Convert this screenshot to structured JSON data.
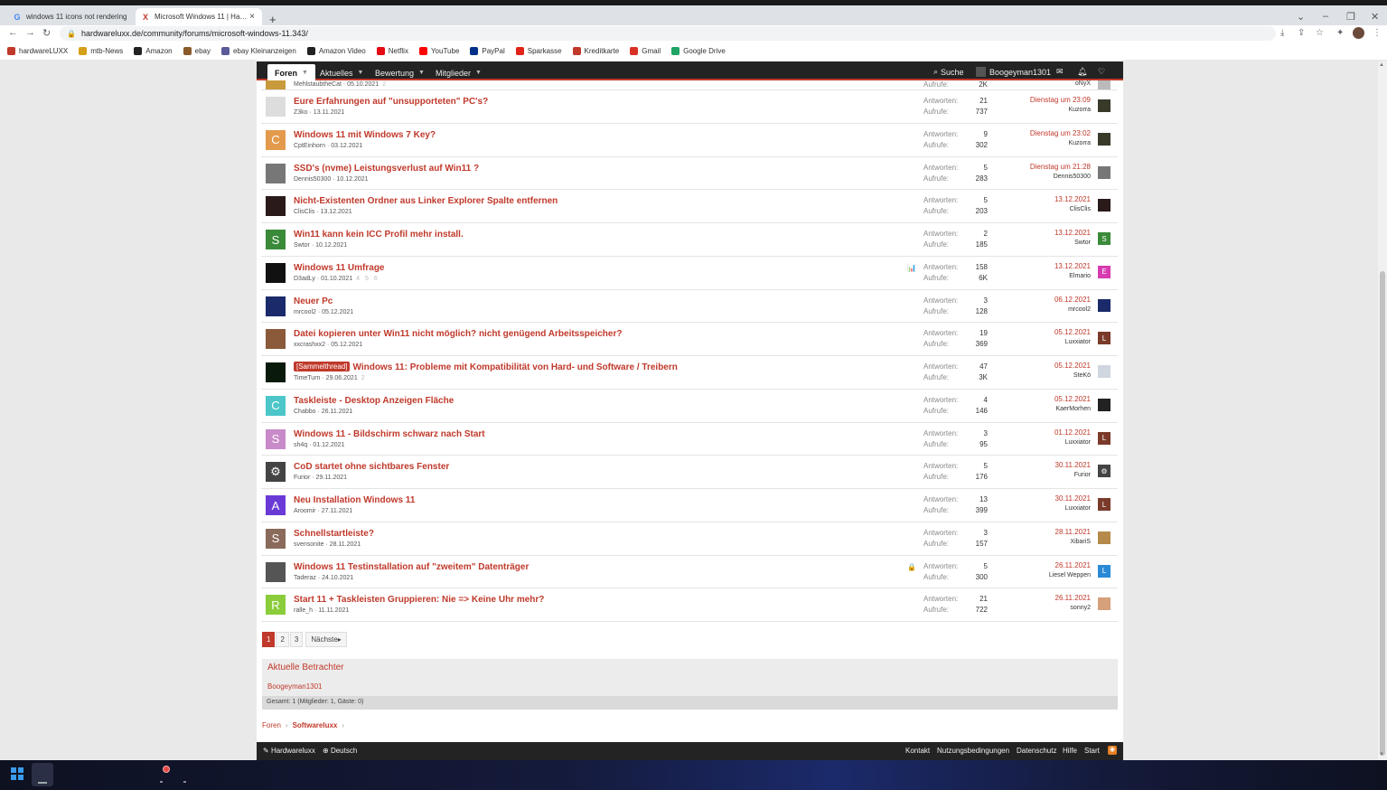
{
  "browser": {
    "tabs": [
      {
        "title": "windows 11 icons not rendering",
        "active": false,
        "favicon": "google-icon"
      },
      {
        "title": "Microsoft Windows 11 | Hardwareluxx",
        "active": true,
        "favicon": "hardwareluxx-icon"
      }
    ],
    "url": "hardwareluxx.de/community/forums/microsoft-windows-11.343/",
    "bookmarks": [
      {
        "label": "hardwareLUXX",
        "icon": "hardwareluxx-icon",
        "color": "#c0392b"
      },
      {
        "label": "mtb-News",
        "icon": "mtb-icon",
        "color": "#d4a017"
      },
      {
        "label": "Amazon",
        "icon": "amazon-icon",
        "color": "#222222"
      },
      {
        "label": "ebay",
        "icon": "ebay-icon",
        "color": "#8a5a2b"
      },
      {
        "label": "ebay Kleinanzeigen",
        "icon": "kleinanzeigen-icon",
        "color": "#5a5a9a"
      },
      {
        "label": "Amazon Video",
        "icon": "amazon-icon",
        "color": "#222222"
      },
      {
        "label": "Netflix",
        "icon": "netflix-icon",
        "color": "#e50914"
      },
      {
        "label": "YouTube",
        "icon": "youtube-icon",
        "color": "#ff0000"
      },
      {
        "label": "PayPal",
        "icon": "paypal-icon",
        "color": "#003087"
      },
      {
        "label": "Sparkasse",
        "icon": "sparkasse-icon",
        "color": "#e2231a"
      },
      {
        "label": "Kreditkarte",
        "icon": "card-icon",
        "color": "#c0392b"
      },
      {
        "label": "Gmail",
        "icon": "gmail-icon",
        "color": "#d93025"
      },
      {
        "label": "Google Drive",
        "icon": "drive-icon",
        "color": "#1fa463"
      }
    ]
  },
  "forum_nav": {
    "items": [
      "Foren",
      "Aktuelles",
      "Bewertung",
      "Mitglieder"
    ],
    "search": "Suche",
    "username": "Boogeyman1301"
  },
  "labels": {
    "replies": "Antworten:",
    "views": "Aufrufe:"
  },
  "threads": [
    {
      "title": "",
      "prefix": "",
      "author": "MehlstaubtheCat",
      "date": "05.10.2021",
      "pages": "2",
      "replies": "",
      "views": "2K",
      "last_date": "",
      "last_user": "oNyX",
      "status_icon": "",
      "av_letter": "",
      "av_color": "#c99a3a",
      "lav_letter": "",
      "lav_color": "#bbbbbb",
      "partial": true
    },
    {
      "title": "Eure Erfahrungen auf \"unsupporteten\" PC's?",
      "prefix": "",
      "author": "Z3ko",
      "date": "13.11.2021",
      "pages": "",
      "replies": "21",
      "views": "737",
      "last_date": "Dienstag um 23:09",
      "last_user": "Kuzorra",
      "status_icon": "",
      "av_letter": "",
      "av_color": "#dddddd",
      "lav_letter": "",
      "lav_color": "#3a3a2a"
    },
    {
      "title": "Windows 11 mit Windows 7 Key?",
      "prefix": "",
      "author": "CptEinhorn",
      "date": "03.12.2021",
      "pages": "",
      "replies": "9",
      "views": "302",
      "last_date": "Dienstag um 23:02",
      "last_user": "Kuzorra",
      "status_icon": "",
      "av_letter": "C",
      "av_color": "#e39a4c",
      "lav_letter": "",
      "lav_color": "#3a3a2a"
    },
    {
      "title": "SSD's (nvme) Leistungsverlust auf Win11 ?",
      "prefix": "",
      "author": "Dennis50300",
      "date": "10.12.2021",
      "pages": "",
      "replies": "5",
      "views": "283",
      "last_date": "Dienstag um 21:28",
      "last_user": "Dennis50300",
      "status_icon": "",
      "av_letter": "",
      "av_color": "#777777",
      "lav_letter": "",
      "lav_color": "#777777"
    },
    {
      "title": "Nicht-Existenten Ordner aus Linker Explorer Spalte entfernen",
      "prefix": "",
      "author": "ClisClis",
      "date": "13.12.2021",
      "pages": "",
      "replies": "5",
      "views": "203",
      "last_date": "13.12.2021",
      "last_user": "ClisClis",
      "status_icon": "",
      "av_letter": "",
      "av_color": "#2a1a1a",
      "lav_letter": "",
      "lav_color": "#2a1a1a"
    },
    {
      "title": "Win11 kann kein ICC Profil mehr install.",
      "prefix": "",
      "author": "Swtor",
      "date": "10.12.2021",
      "pages": "",
      "replies": "2",
      "views": "185",
      "last_date": "13.12.2021",
      "last_user": "Swtor",
      "status_icon": "",
      "av_letter": "S",
      "av_color": "#3a8a3a",
      "lav_letter": "S",
      "lav_color": "#3a8a3a"
    },
    {
      "title": "Windows 11 Umfrage",
      "prefix": "",
      "author": "D3adLy",
      "date": "01.10.2021",
      "pages": "4 5 6",
      "replies": "158",
      "views": "6K",
      "last_date": "13.12.2021",
      "last_user": "Elmario",
      "status_icon": "📊",
      "av_letter": "",
      "av_color": "#111111",
      "lav_letter": "E",
      "lav_color": "#d63bb0"
    },
    {
      "title": "Neuer Pc",
      "prefix": "",
      "author": "mrcool2",
      "date": "05.12.2021",
      "pages": "",
      "replies": "3",
      "views": "128",
      "last_date": "06.12.2021",
      "last_user": "mrcool2",
      "status_icon": "",
      "av_letter": "",
      "av_color": "#1a2a6a",
      "lav_letter": "",
      "lav_color": "#1a2a6a"
    },
    {
      "title": "Datei kopieren unter Win11 nicht möglich? nicht genügend Arbeitsspeicher?",
      "prefix": "",
      "author": "xxcrashxx2",
      "date": "05.12.2021",
      "pages": "",
      "replies": "19",
      "views": "369",
      "last_date": "05.12.2021",
      "last_user": "Luxxiator",
      "status_icon": "",
      "av_letter": "",
      "av_color": "#8a5a3a",
      "lav_letter": "L",
      "lav_color": "#7a3a2a"
    },
    {
      "title": "Windows 11: Probleme mit Kompatibilität von Hard- und Software / Treibern",
      "prefix": "[Sammelthread]",
      "author": "TimeTurn",
      "date": "29.06.2021",
      "pages": "2",
      "replies": "47",
      "views": "3K",
      "last_date": "05.12.2021",
      "last_user": "SteKö",
      "status_icon": "",
      "av_letter": "",
      "av_color": "#0a1a0a",
      "lav_letter": "",
      "lav_color": "#d0d6e0"
    },
    {
      "title": "Taskleiste - Desktop Anzeigen Fläche",
      "prefix": "",
      "author": "Chabbo",
      "date": "26.11.2021",
      "pages": "",
      "replies": "4",
      "views": "146",
      "last_date": "05.12.2021",
      "last_user": "KaerMorhen",
      "status_icon": "",
      "av_letter": "C",
      "av_color": "#4cc6c9",
      "lav_letter": "",
      "lav_color": "#222222"
    },
    {
      "title": "Windows 11 - Bildschirm schwarz nach Start",
      "prefix": "",
      "author": "sh4q",
      "date": "01.12.2021",
      "pages": "",
      "replies": "3",
      "views": "95",
      "last_date": "01.12.2021",
      "last_user": "Luxxiator",
      "status_icon": "",
      "av_letter": "S",
      "av_color": "#c98ac9",
      "lav_letter": "L",
      "lav_color": "#7a3a2a"
    },
    {
      "title": "CoD startet ohne sichtbares Fenster",
      "prefix": "",
      "author": "Furior",
      "date": "29.11.2021",
      "pages": "",
      "replies": "5",
      "views": "176",
      "last_date": "30.11.2021",
      "last_user": "Furior",
      "status_icon": "",
      "av_letter": "⚙",
      "av_color": "#444444",
      "lav_letter": "⚙",
      "lav_color": "#444444"
    },
    {
      "title": "Neu Installation Windows 11",
      "prefix": "",
      "author": "Aroomir",
      "date": "27.11.2021",
      "pages": "",
      "replies": "13",
      "views": "399",
      "last_date": "30.11.2021",
      "last_user": "Luxxiator",
      "status_icon": "",
      "av_letter": "A",
      "av_color": "#6a3ad6",
      "lav_letter": "L",
      "lav_color": "#7a3a2a"
    },
    {
      "title": "Schnellstartleiste?",
      "prefix": "",
      "author": "svensonite",
      "date": "28.11.2021",
      "pages": "",
      "replies": "3",
      "views": "157",
      "last_date": "28.11.2021",
      "last_user": "XibariS",
      "status_icon": "",
      "av_letter": "S",
      "av_color": "#8a6a5a",
      "lav_letter": "",
      "lav_color": "#b58a4a"
    },
    {
      "title": "Windows 11 Testinstallation auf \"zweitem\" Datenträger",
      "prefix": "",
      "author": "Taderaz",
      "date": "24.10.2021",
      "pages": "",
      "replies": "5",
      "views": "300",
      "last_date": "26.11.2021",
      "last_user": "Liesel Weppen",
      "status_icon": "🔒",
      "av_letter": "",
      "av_color": "#555555",
      "lav_letter": "L",
      "lav_color": "#2a8ad6"
    },
    {
      "title": "Start 11 + Taskleisten Gruppieren: Nie => Keine Uhr mehr?",
      "prefix": "",
      "author": "ralle_h",
      "date": "11.11.2021",
      "pages": "",
      "replies": "21",
      "views": "722",
      "last_date": "26.11.2021",
      "last_user": "sonny2",
      "status_icon": "",
      "av_letter": "R",
      "av_color": "#8acc3a",
      "lav_letter": "",
      "lav_color": "#d6a07a"
    }
  ],
  "pagination": {
    "pages": [
      "1",
      "2",
      "3"
    ],
    "next": "Nächste"
  },
  "viewers": {
    "title": "Aktuelle Betrachter",
    "user": "Boogeyman1301",
    "total": "Gesamt: 1 (Mitglieder: 1, Gäste: 0)"
  },
  "breadcrumb": [
    "Foren",
    "Softwareluxx"
  ],
  "footer": {
    "left": [
      "Hardwareluxx",
      "Deutsch"
    ],
    "right": [
      "Kontakt",
      "Nutzungsbedingungen",
      "Datenschutz",
      "Hilfe",
      "Start"
    ]
  }
}
